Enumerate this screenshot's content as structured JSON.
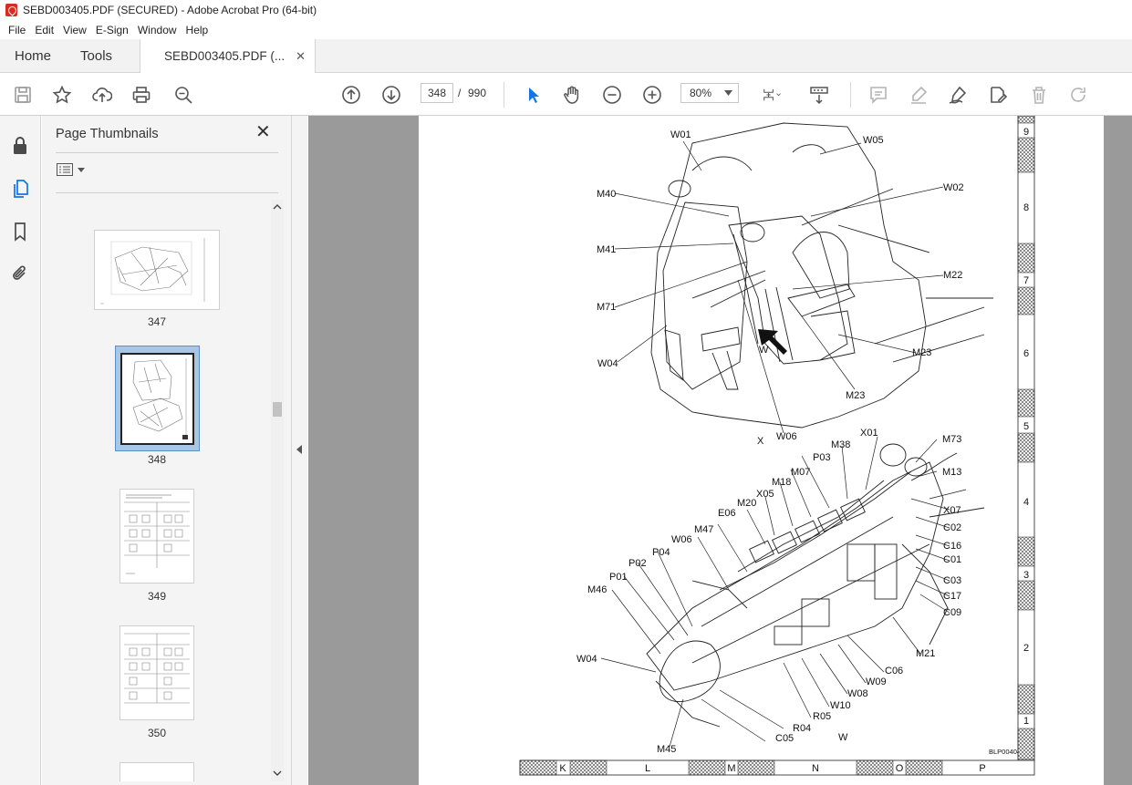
{
  "window": {
    "title": "SEBD003405.PDF (SECURED) - Adobe Acrobat Pro (64-bit)"
  },
  "menu": [
    "File",
    "Edit",
    "View",
    "E-Sign",
    "Window",
    "Help"
  ],
  "tabs": {
    "home": "Home",
    "tools": "Tools",
    "document": "SEBD003405.PDF (...",
    "close_glyph": "✕"
  },
  "toolbar": {
    "current_page": "348",
    "page_separator": "/",
    "total_pages": "990",
    "zoom": "80%"
  },
  "sidebar": {
    "title": "Page Thumbnails",
    "thumbnails": [
      {
        "page": "347"
      },
      {
        "page": "348",
        "selected": true
      },
      {
        "page": "349"
      },
      {
        "page": "350"
      }
    ]
  },
  "diagram": {
    "top_callouts": [
      "W01",
      "W05",
      "W02",
      "M40",
      "M41",
      "M22",
      "M71",
      "W04",
      "W",
      "M23",
      "M23",
      "X",
      "W06"
    ],
    "bottom_callouts": [
      "X01",
      "M73",
      "M38",
      "P03",
      "M13",
      "M07",
      "M18",
      "X05",
      "M20",
      "E06",
      "M47",
      "W06",
      "P04",
      "P02",
      "P01",
      "M46",
      "X07",
      "C02",
      "C16",
      "C01",
      "C03",
      "C17",
      "C09",
      "M21",
      "W04",
      "C06",
      "W09",
      "W08",
      "W10",
      "R05",
      "R04",
      "C05",
      "W",
      "M45"
    ],
    "figure_code": "BLP00404",
    "side_scale": [
      "9",
      "8",
      "7",
      "6",
      "5",
      "4",
      "3",
      "2",
      "1"
    ],
    "bottom_scale": [
      "K",
      "L",
      "M",
      "N",
      "O",
      "P"
    ]
  },
  "colors": {
    "accent": "#1473e6",
    "title_icon": "#d62d20",
    "doc_background": "#9a9a9a",
    "selection": "#a9c6e4"
  }
}
